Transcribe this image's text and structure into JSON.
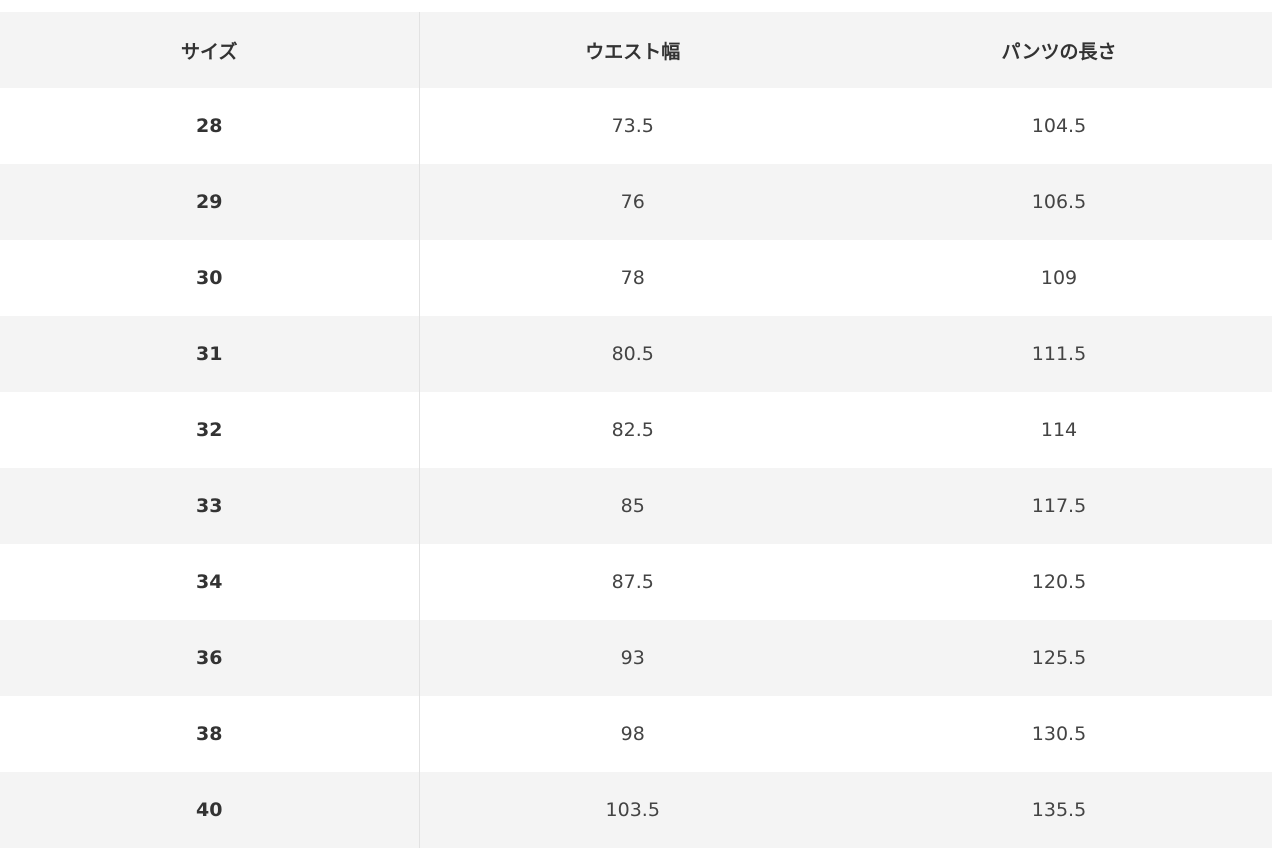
{
  "table": {
    "headers": [
      "サイズ",
      "ウエスト幅",
      "パンツの長さ"
    ],
    "rows": [
      [
        "28",
        "73.5",
        "104.5"
      ],
      [
        "29",
        "76",
        "106.5"
      ],
      [
        "30",
        "78",
        "109"
      ],
      [
        "31",
        "80.5",
        "111.5"
      ],
      [
        "32",
        "82.5",
        "114"
      ],
      [
        "33",
        "85",
        "117.5"
      ],
      [
        "34",
        "87.5",
        "120.5"
      ],
      [
        "36",
        "93",
        "125.5"
      ],
      [
        "38",
        "98",
        "130.5"
      ],
      [
        "40",
        "103.5",
        "135.5"
      ]
    ]
  },
  "colors": {
    "stripe": "#f4f4f4",
    "background": "#ffffff",
    "divider": "#e2e2e2",
    "text": "#333333"
  }
}
